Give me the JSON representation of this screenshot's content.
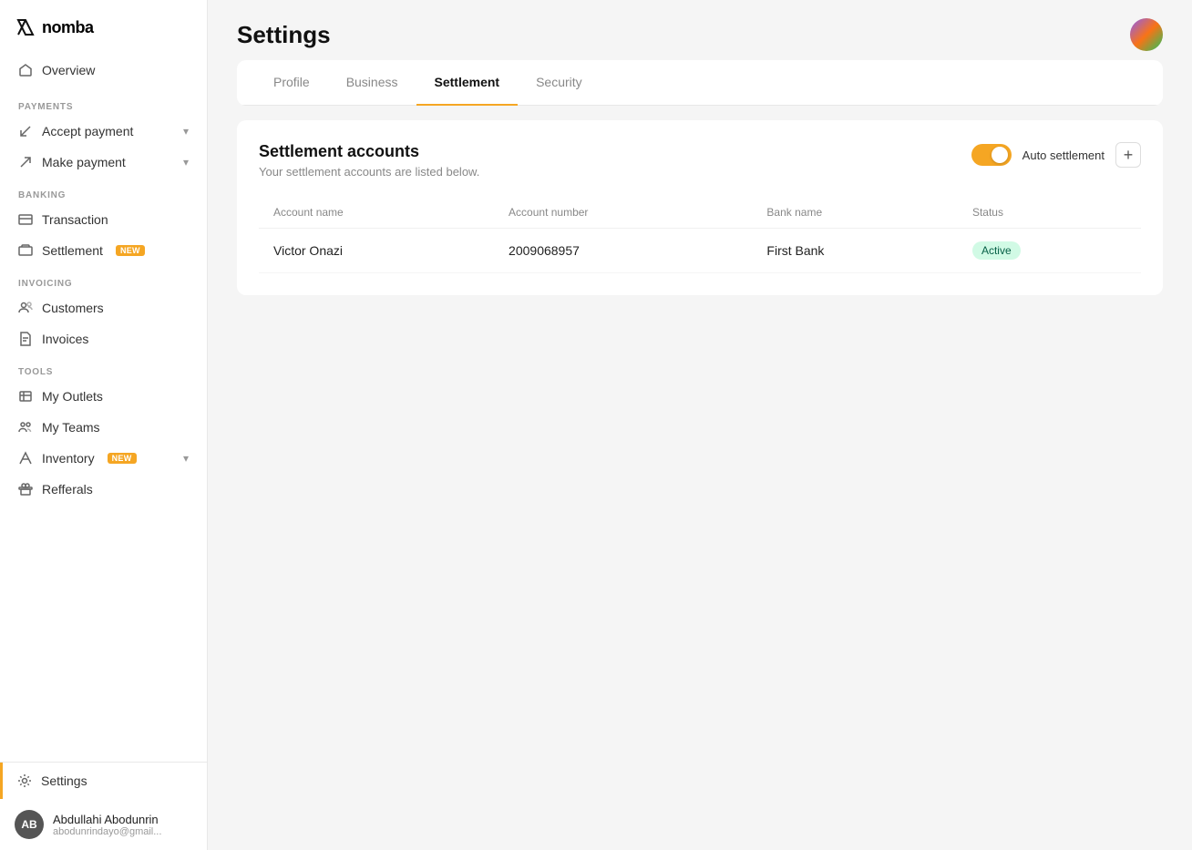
{
  "app": {
    "logo_text": "nomba"
  },
  "sidebar": {
    "overview_label": "Overview",
    "sections": {
      "payments": "PAYMENTS",
      "banking": "BANKING",
      "invoicing": "INVOICING",
      "tools": "TOOLS"
    },
    "nav_items": {
      "accept_payment": "Accept payment",
      "make_payment": "Make payment",
      "transaction": "Transaction",
      "settlement": "Settlement",
      "customers": "Customers",
      "invoices": "Invoices",
      "my_outlets": "My Outlets",
      "my_teams": "My Teams",
      "inventory": "Inventory",
      "refferals": "Refferals"
    },
    "badges": {
      "new": "NEW"
    },
    "settings_label": "Settings",
    "user": {
      "initials": "AB",
      "name": "Abdullahi Abodunrin",
      "email": "abodunrindayo@gmail..."
    }
  },
  "header": {
    "title": "Settings"
  },
  "tabs": {
    "profile": "Profile",
    "business": "Business",
    "settlement": "Settlement",
    "security": "Security"
  },
  "settlement_section": {
    "title": "Settlement accounts",
    "subtitle": "Your settlement accounts are listed below.",
    "auto_settlement_label": "Auto settlement",
    "table": {
      "columns": [
        "Account name",
        "Account number",
        "Bank name",
        "Status"
      ],
      "rows": [
        {
          "account_name": "Victor Onazi",
          "account_number": "2009068957",
          "bank_name": "First Bank",
          "status": "Active"
        }
      ]
    }
  }
}
